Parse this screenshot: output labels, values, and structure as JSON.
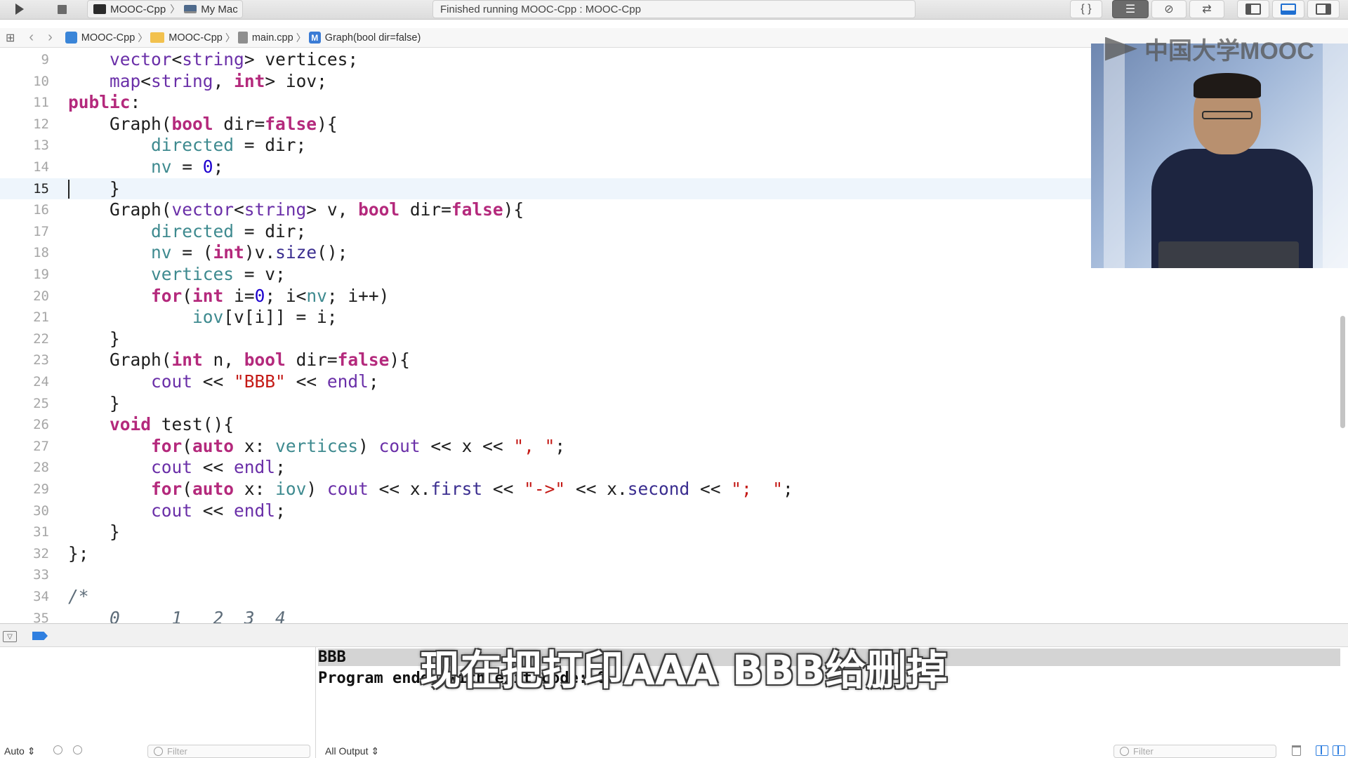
{
  "toolbar": {
    "scheme_name": "MOOC-Cpp",
    "scheme_sep": "〉",
    "destination": "My Mac",
    "activity_text": "Finished running MOOC-Cpp : MOOC-Cpp",
    "icons": [
      "run-icon",
      "stop-icon",
      "braces-icon",
      "standard-editor-icon",
      "assistant-editor-icon",
      "version-editor-icon",
      "navigator-panel-icon",
      "debug-panel-icon",
      "utilities-panel-icon"
    ]
  },
  "jumpbar": {
    "crumbs": [
      "MOOC-Cpp",
      "MOOC-Cpp",
      "main.cpp",
      "Graph(bool dir=false)"
    ],
    "sep": "〉"
  },
  "editor": {
    "current_line": 15,
    "lines": [
      {
        "n": "9"
      },
      {
        "n": "10"
      },
      {
        "n": "11"
      },
      {
        "n": "12"
      },
      {
        "n": "13"
      },
      {
        "n": "14"
      },
      {
        "n": "15"
      },
      {
        "n": "16"
      },
      {
        "n": "17"
      },
      {
        "n": "18"
      },
      {
        "n": "19"
      },
      {
        "n": "20"
      },
      {
        "n": "21"
      },
      {
        "n": "22"
      },
      {
        "n": "23"
      },
      {
        "n": "24"
      },
      {
        "n": "25"
      },
      {
        "n": "26"
      },
      {
        "n": "27"
      },
      {
        "n": "28"
      },
      {
        "n": "29"
      },
      {
        "n": "30"
      },
      {
        "n": "31"
      },
      {
        "n": "32"
      },
      {
        "n": "33"
      },
      {
        "n": "34"
      },
      {
        "n": "35"
      }
    ]
  },
  "video": {
    "logo_text": "中国大学MOOC"
  },
  "console": {
    "lines": [
      "BBB",
      "Program ended with exit code: 0"
    ]
  },
  "subtitle": "现在把打印AAA BBB给删掉",
  "bottom": {
    "auto_label": "Auto ⇕",
    "filter_placeholder": "Filter",
    "output_label": "All Output ⇕"
  },
  "colors": {
    "keyword": "#b4297c",
    "type": "#6a2fa8",
    "variable": "#3e8a8f",
    "number": "#1c00cf",
    "string": "#c41a16",
    "accent": "#2f7fe0"
  }
}
